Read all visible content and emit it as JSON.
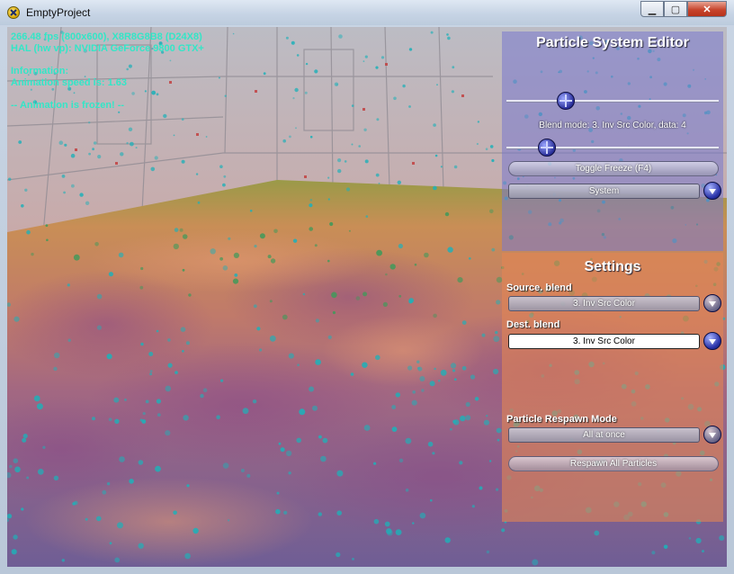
{
  "window": {
    "title": "EmptyProject",
    "minimize_glyph": "▁",
    "maximize_glyph": "▢",
    "close_glyph": "✕"
  },
  "hud": {
    "line1": "266.48 fps (800x600), X8R8G8B8 (D24X8)",
    "line2": "HAL (hw vp): NVIDIA GeForce 9800 GTX+",
    "info_header": "Information:",
    "anim_speed": "Animation speed is: 1.63",
    "frozen": "-- Animation is frozen! --"
  },
  "editor": {
    "title": "Particle System Editor",
    "slider1_level": 0.28,
    "blend_mode_label": "Blend mode: 3. Inv Src Color, data: 4",
    "slider2_level": 0.19,
    "toggle_freeze": "Toggle Freeze (F4)",
    "system_combo": "System"
  },
  "settings": {
    "title": "Settings",
    "source_blend_label": "Source. blend",
    "source_blend_value": "3. Inv Src Color",
    "dest_blend_label": "Dest. blend",
    "dest_blend_value": "3. Inv Src Color",
    "respawn_mode_label": "Particle Respawn Mode",
    "respawn_mode_value": "All at once",
    "respawn_button": "Respawn All Particles"
  },
  "colors": {
    "hud_text": "#33e6c7",
    "editor_panel": "#7878cd",
    "settings_panel": "#e28654",
    "particle": "#1fb0b8"
  }
}
